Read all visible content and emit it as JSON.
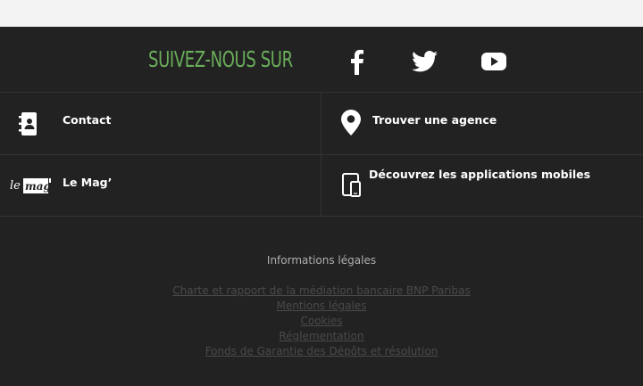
{
  "social": {
    "follow_label": "SUIVEZ-NOUS SUR",
    "networks": [
      "facebook-icon",
      "twitter-icon",
      "youtube-icon"
    ],
    "accent_color": "#6aad5a"
  },
  "links": {
    "contact": "Contact",
    "agency": "Trouver une agence",
    "mag": "Le Mag’",
    "mag_logo_text_le": "le",
    "mag_logo_text_mag": "mag",
    "apps": "Découvrez les applications mobiles"
  },
  "legal": {
    "title": "Informations légales",
    "items": [
      "Charte et rapport de la médiation bancaire BNP Paribas",
      "Mentions légales",
      "Cookies",
      "Réglementation",
      "Fonds de Garantie des Dépôts et résolution"
    ]
  }
}
